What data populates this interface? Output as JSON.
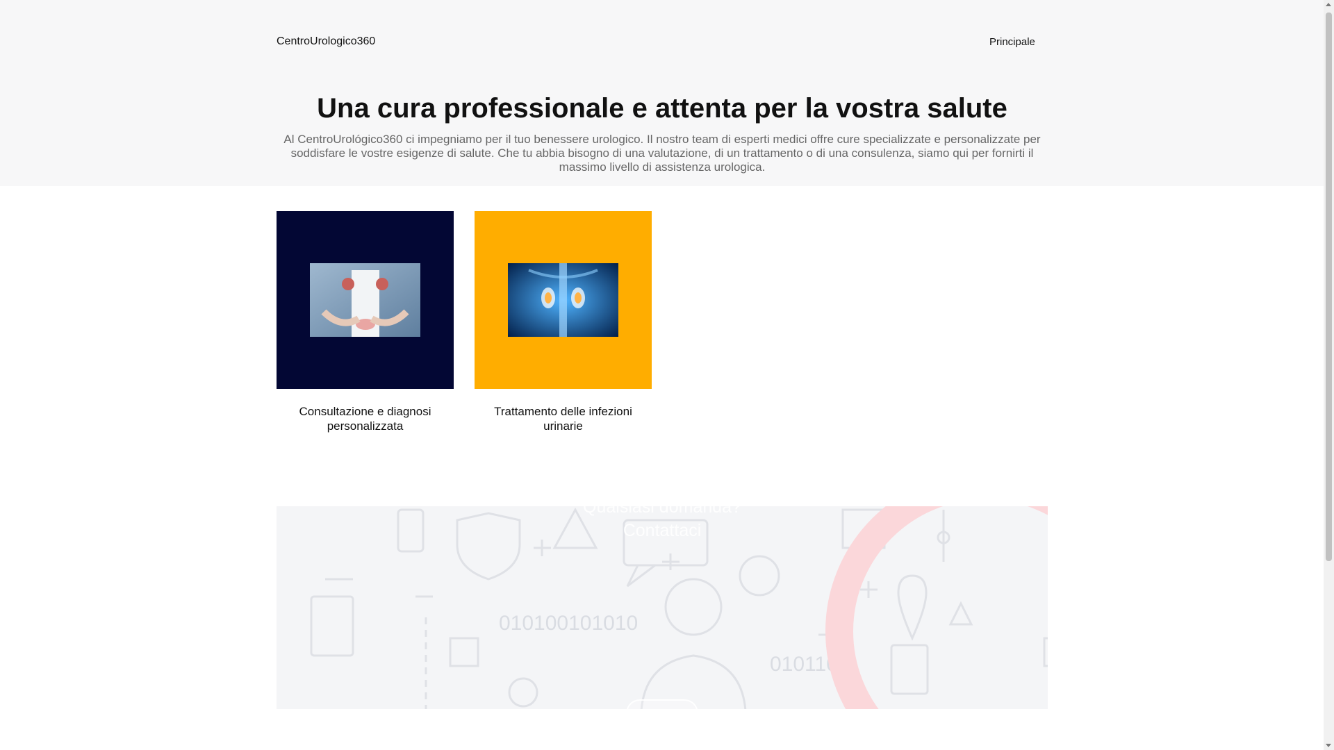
{
  "header": {
    "brand": "CentroUrologico360",
    "nav": [
      "Principale"
    ]
  },
  "hero": {
    "title": "Una cura professionale e attenta per la vostra salute",
    "text": "Al CentroUrológico360 ci impegniamo per il tuo benessere urologico. Il nostro team di esperti medici offre cure specializzate e personalizzate per soddisfare le vostre esigenze di salute. Che tu abbia bisogno di una valutazione, di un trattamento o di una consulenza, siamo qui per fornirti il massimo livello di assistenza urologica."
  },
  "services": [
    {
      "label": "Consultazione e diagnosi personalizzata",
      "color": "#030734"
    },
    {
      "label": "Trattamento delle infezioni urinarie",
      "color": "#ffad00"
    }
  ],
  "contact": {
    "title_line1": "Qualsiasi domanda?",
    "title_line2": "Contattaci",
    "button": ""
  },
  "colors": {
    "hero_bg": "#f7f7f8",
    "card_dark": "#030734",
    "card_orange": "#ffad00",
    "accent_red": "#e63946"
  }
}
